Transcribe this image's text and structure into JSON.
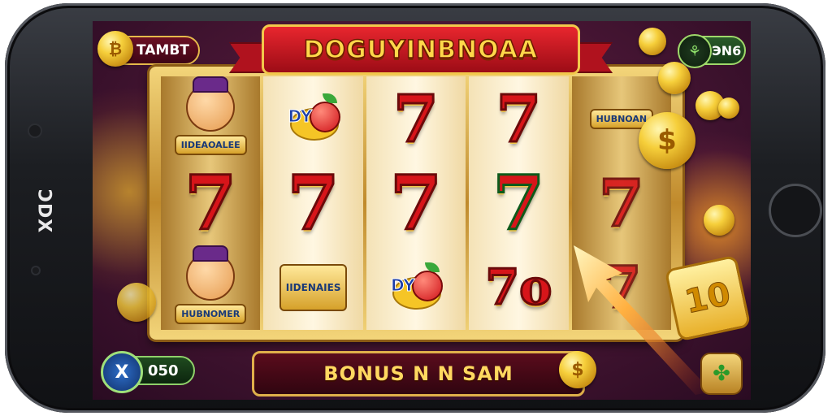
{
  "device": {
    "side_label": "ƆDX"
  },
  "game": {
    "title": "DOGUYINBNOAA",
    "top_left": {
      "coin_symbol": "₿",
      "label": "TAMBT"
    },
    "top_right": {
      "icon_symbol": "⚘",
      "value": "ЭN6"
    },
    "bottom_left": {
      "icon_symbol": "X",
      "value": "050"
    },
    "bottom_right": {
      "icon_symbol": "✤"
    },
    "bonus_text": "BONUS N N SAM",
    "bonus_coin_symbol": "$",
    "multiplier": "10",
    "reels": [
      [
        {
          "type": "character",
          "label": "IIDEAOALEE"
        },
        {
          "type": "seven",
          "text": "7"
        },
        {
          "type": "character",
          "label": "HUBNOMER"
        }
      ],
      [
        {
          "type": "fruit",
          "label": "DY"
        },
        {
          "type": "seven",
          "text": "7"
        },
        {
          "type": "badge",
          "label": "IIDENAIES"
        }
      ],
      [
        {
          "type": "seven",
          "text": "7"
        },
        {
          "type": "seven",
          "text": "7"
        },
        {
          "type": "fruit",
          "label": "DY"
        }
      ],
      [
        {
          "type": "seven",
          "text": "7"
        },
        {
          "type": "seven",
          "text": "7"
        },
        {
          "type": "seven",
          "text": "7o"
        }
      ],
      [
        {
          "type": "badge",
          "label": "HUBNOAN"
        },
        {
          "type": "seven",
          "text": "7"
        },
        {
          "type": "seven",
          "text": "7"
        }
      ]
    ],
    "floating_coin_symbol": "$",
    "colors": {
      "accent_gold": "#f2c84b",
      "seven_red": "#d7151a",
      "banner_red": "#b0121e"
    }
  }
}
